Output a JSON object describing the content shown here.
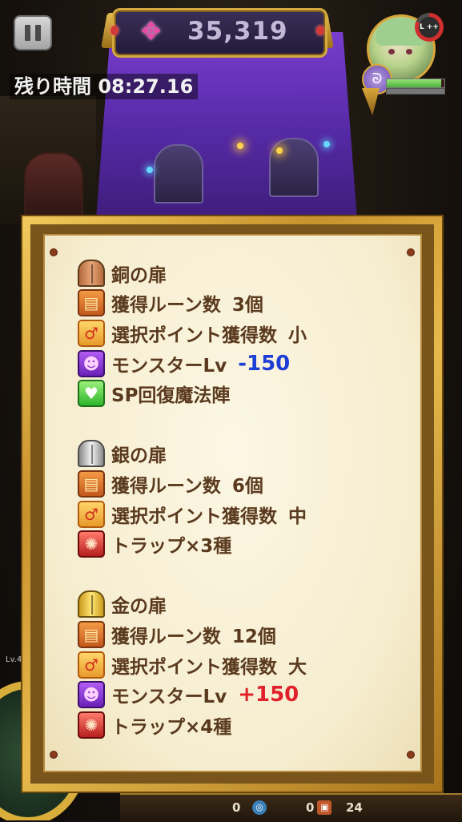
{
  "hud": {
    "score": "35,319",
    "timer": "残り時間  08:27.16",
    "skill_label": "L ++",
    "element_icon": "ᘐ",
    "hp_ratio": 0.95,
    "left_level_label": "Lv.4"
  },
  "colors": {
    "panel_text": "#5a3a1e",
    "negative_value": "#1d3fd6",
    "positive_value": "#e0202a",
    "frame_gold": "#d2a93d"
  },
  "panel": {
    "sections": [
      {
        "title": "銅の扉",
        "door_icon": "bronze-door-icon",
        "rows": [
          {
            "icon": "treasure-chest-icon",
            "label": "獲得ルーン数",
            "value": "3個"
          },
          {
            "icon": "selection-point-icon",
            "label": "選択ポイント獲得数",
            "value": "小"
          },
          {
            "icon": "monster-icon",
            "label": "モンスターLv",
            "value": "-150"
          },
          {
            "icon": "heart-heal-icon",
            "label": "SP回復魔法陣",
            "value": ""
          }
        ]
      },
      {
        "title": "銀の扉",
        "door_icon": "silver-door-icon",
        "rows": [
          {
            "icon": "treasure-chest-icon",
            "label": "獲得ルーン数",
            "value": "6個"
          },
          {
            "icon": "selection-point-icon",
            "label": "選択ポイント獲得数",
            "value": "中"
          },
          {
            "icon": "trap-icon",
            "label": "トラップ×3種",
            "value": ""
          }
        ]
      },
      {
        "title": "金の扉",
        "door_icon": "gold-door-icon",
        "rows": [
          {
            "icon": "treasure-chest-icon",
            "label": "獲得ルーン数",
            "value": "12個"
          },
          {
            "icon": "selection-point-icon",
            "label": "選択ポイント獲得数",
            "value": "大"
          },
          {
            "icon": "monster-icon",
            "label": "モンスターLv",
            "value": "+150"
          },
          {
            "icon": "trap-icon",
            "label": "トラップ×4種",
            "value": ""
          }
        ]
      }
    ]
  },
  "bottom_hud": {
    "count_a": "0",
    "count_b": "0",
    "count_c": "24"
  }
}
